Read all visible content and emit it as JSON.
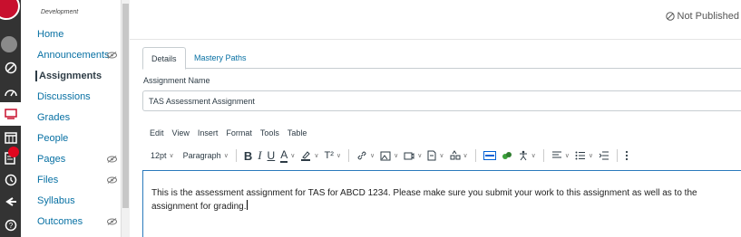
{
  "course_nav": {
    "crumb": "Development",
    "links": [
      {
        "label": "Home"
      },
      {
        "label": "Announcements"
      },
      {
        "label": "Assignments"
      },
      {
        "label": "Discussions"
      },
      {
        "label": "Grades"
      },
      {
        "label": "People"
      },
      {
        "label": "Pages"
      },
      {
        "label": "Files"
      },
      {
        "label": "Syllabus"
      },
      {
        "label": "Outcomes"
      }
    ]
  },
  "header": {
    "status": "Not Published"
  },
  "tabs": {
    "details": "Details",
    "mastery": "Mastery Paths"
  },
  "form": {
    "name_label": "Assignment Name",
    "name_value": "TAS Assessment Assignment"
  },
  "menubar": [
    "Edit",
    "View",
    "Insert",
    "Format",
    "Tools",
    "Table"
  ],
  "toolbar": {
    "font_size": "12pt",
    "block": "Paragraph"
  },
  "editor": {
    "body": "This is the assessment assignment for TAS for ABCD 1234.  Please make sure you submit your work to this assignment as well as to the assignment for grading."
  },
  "colors": {
    "link": "#0770a3",
    "nav_bg": "#333333",
    "brand": "#c8102e",
    "focus": "#2b7abc"
  }
}
